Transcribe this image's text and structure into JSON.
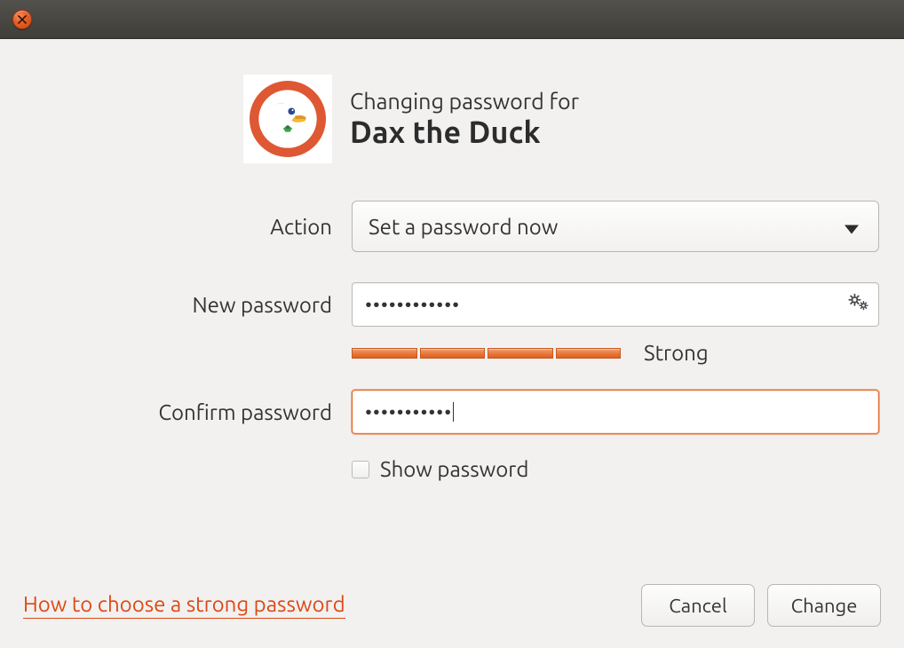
{
  "header": {
    "subtitle": "Changing password for",
    "username": "Dax the Duck"
  },
  "form": {
    "action_label": "Action",
    "action_value": "Set a password now",
    "new_password_label": "New password",
    "new_password_value": "••••••••••••",
    "strength_label": "Strong",
    "confirm_label": "Confirm password",
    "confirm_value": "•••••••••••",
    "show_password_label": "Show password"
  },
  "footer": {
    "help_link": "How to choose a strong password",
    "cancel": "Cancel",
    "change": "Change"
  }
}
